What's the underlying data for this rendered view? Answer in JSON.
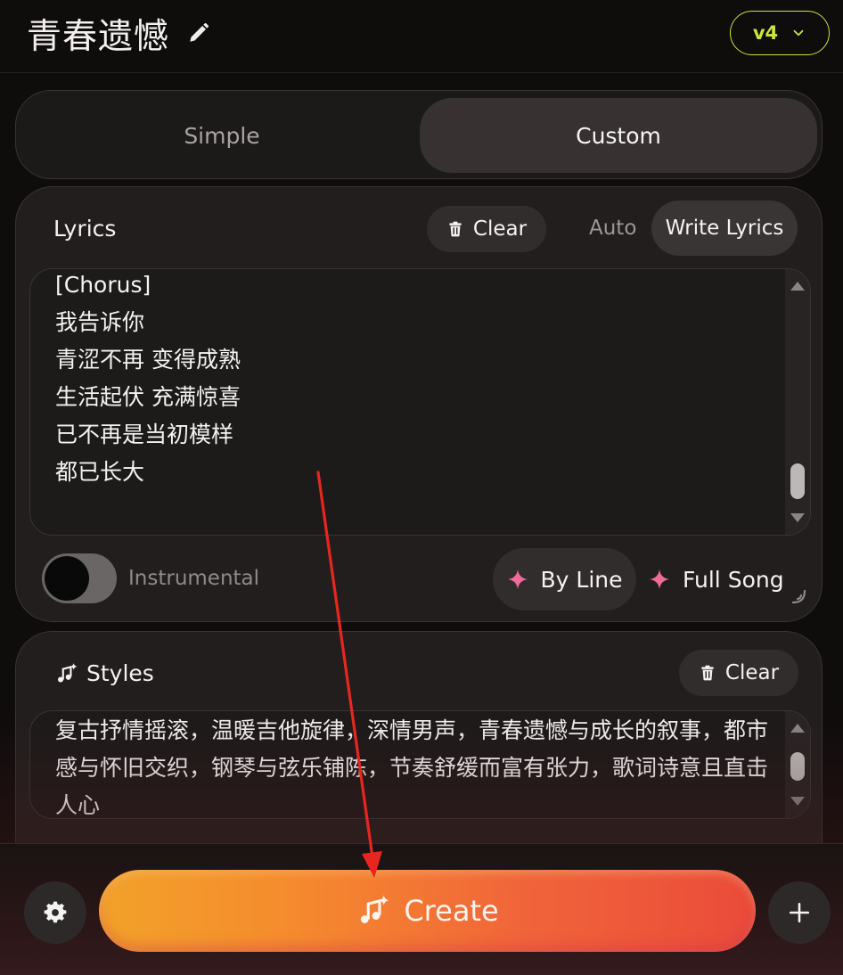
{
  "header": {
    "title": "青春遗憾",
    "version": "v4"
  },
  "mode": {
    "tabs": [
      {
        "label": "Simple",
        "selected": false
      },
      {
        "label": "Custom",
        "selected": true
      }
    ]
  },
  "lyrics": {
    "label": "Lyrics",
    "clear_label": "Clear",
    "auto_label": "Auto",
    "write_label": "Write Lyrics",
    "lines": [
      "[Chorus]",
      "我告诉你",
      "青涩不再 变得成熟",
      "生活起伏 充满惊喜",
      "已不再是当初模样",
      "都已长大"
    ],
    "instrumental_label": "Instrumental",
    "instrumental_on": false,
    "by_line_label": "By Line",
    "full_song_label": "Full Song"
  },
  "styles": {
    "label": "Styles",
    "clear_label": "Clear",
    "text": "复古抒情摇滚，温暖吉他旋律，深情男声，青春遗憾与成长的叙事，都市感与怀旧交织，钢琴与弦乐铺陈，节奏舒缓而富有张力，歌词诗意且直击人心"
  },
  "actions": {
    "create_label": "Create"
  },
  "colors": {
    "accent_version": "#c8e63a",
    "sparkle": "#f06a9a",
    "create_start": "#f2a22a",
    "create_end": "#ea4b3a",
    "annotation_arrow": "#e8261f"
  },
  "icons": {
    "title_edit": "pencil-icon",
    "version_dropdown": "chevron-down-icon",
    "clear": "trash-icon",
    "sparkle": "sparkle-icon",
    "styles": "music-note-sparkle-icon",
    "settings": "gear-icon",
    "add": "plus-icon"
  }
}
